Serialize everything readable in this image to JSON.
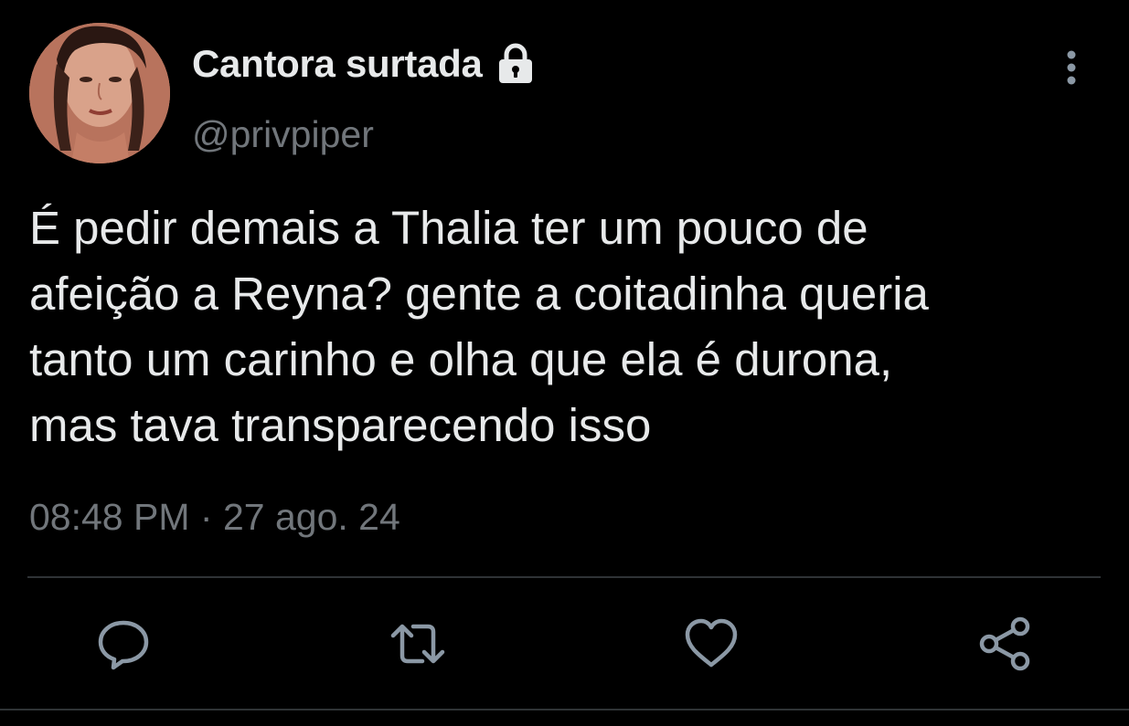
{
  "user": {
    "display_name": "Cantora surtada",
    "handle": "@privpiper",
    "protected_icon": "lock-icon",
    "avatar": "profile-photo"
  },
  "tweet": {
    "text": "É pedir demais a Thalia ter um pouco de\nafeição a Reyna? gente a coitadinha queria\ntanto um carinho e olha que ela é durona,\nmas tava transparecendo isso",
    "time": "08:48 PM",
    "separator": "·",
    "date": "27 ago. 24"
  },
  "actions": {
    "reply": "reply-icon",
    "retweet": "retweet-icon",
    "like": "heart-icon",
    "share": "share-icon",
    "more": "more-vertical-icon"
  },
  "colors": {
    "background": "#000000",
    "primary_text": "#e7e9ea",
    "secondary_text": "#71767b",
    "action_icon": "#8b98a5",
    "divider": "#2f3336"
  }
}
